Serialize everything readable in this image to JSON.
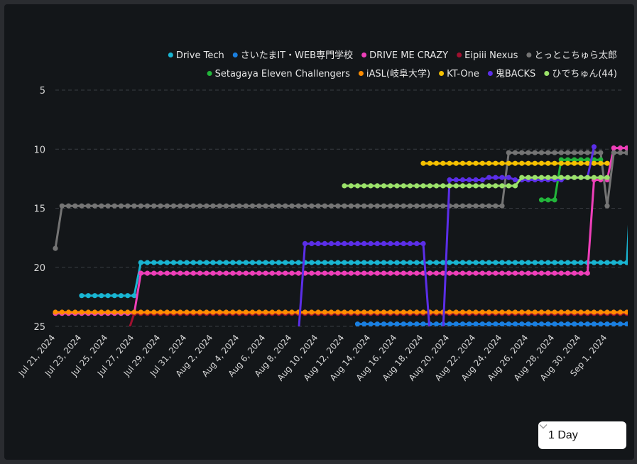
{
  "chart_data": {
    "type": "line",
    "title": "",
    "xlabel": "",
    "ylabel": "",
    "y_axis_reversed": true,
    "ylim": [
      5,
      25
    ],
    "yticks": [
      5,
      10,
      15,
      20,
      25
    ],
    "xticks": [
      "Jul 21, 2024",
      "Jul 23, 2024",
      "Jul 25, 2024",
      "Jul 27, 2024",
      "Jul 29, 2024",
      "Jul 31, 2024",
      "Aug 2, 2024",
      "Aug 4, 2024",
      "Aug 6, 2024",
      "Aug 8, 2024",
      "Aug 10, 2024",
      "Aug 12, 2024",
      "Aug 14, 2024",
      "Aug 16, 2024",
      "Aug 18, 2024",
      "Aug 20, 2024",
      "Aug 22, 2024",
      "Aug 24, 2024",
      "Aug 26, 2024",
      "Aug 28, 2024",
      "Aug 30, 2024",
      "Sep 1, 2024"
    ],
    "xlim": [
      "2024-07-21",
      "2024-09-01.5"
    ],
    "grid": "horizontal dashed",
    "legend_position": "top-right",
    "series": [
      {
        "name": "Drive Tech",
        "color": "#19b5d2",
        "segments": [
          {
            "start": "2024-07-23",
            "values": [
              22.4,
              22.4,
              22.4,
              22.4,
              22.4,
              22.4,
              22.4,
              22.4,
              22.4,
              19.6,
              19.6,
              19.6,
              19.6,
              19.6,
              19.6,
              19.6,
              19.6,
              19.6,
              19.6,
              19.6,
              19.6,
              19.6,
              19.6,
              19.6,
              19.6,
              19.6,
              19.6,
              19.6,
              19.6,
              19.6,
              19.6,
              19.6,
              19.6,
              19.6,
              19.6,
              19.6,
              19.6,
              19.6,
              19.6,
              19.6,
              19.6,
              19.6,
              19.6,
              19.6,
              19.6,
              19.6,
              19.6,
              19.6,
              19.6,
              19.6,
              19.6,
              19.6,
              19.6,
              19.6,
              19.6,
              19.6,
              19.6,
              19.6,
              19.6,
              19.6,
              19.6,
              19.6,
              19.6,
              19.6,
              19.6,
              19.6,
              19.6,
              19.6,
              19.6,
              19.6,
              19.6,
              19.6,
              19.6,
              19.6,
              19.6,
              19.6,
              19.6,
              19.6,
              19.6,
              19.6,
              19.6,
              19.6,
              19.6,
              19.6,
              8.7,
              8.7,
              8.7
            ]
          }
        ]
      },
      {
        "name": "さいたまIT・WEB専門学校",
        "color": "#1a7fe0",
        "segments": [
          {
            "start": "2024-08-13",
            "values": [
              24.8,
              24.8,
              24.8,
              24.8,
              24.8,
              24.8,
              24.8,
              24.8,
              24.8,
              24.8,
              24.8,
              24.8,
              24.8,
              24.8,
              24.8,
              24.8,
              24.8,
              24.8,
              24.8,
              24.8,
              24.8,
              24.8,
              24.8,
              24.8,
              24.8,
              24.8,
              24.8,
              24.8,
              24.8,
              24.8,
              24.8,
              24.8,
              24.8,
              24.8,
              24.8,
              24.8,
              24.8,
              24.8,
              24.8,
              24.8,
              24.8,
              24.8,
              24.8,
              24.8,
              24.8,
              24.8,
              24.8,
              24.8,
              24.8,
              24.8,
              24.8,
              12.4,
              9.8
            ]
          }
        ]
      },
      {
        "name": "DRIVE ME CRAZY",
        "color": "#ee3fb9",
        "segments": [
          {
            "start": "2024-07-21",
            "values": [
              23.9,
              23.9,
              23.9,
              23.9,
              23.9,
              23.9,
              23.9,
              23.9,
              23.9,
              23.9,
              23.9,
              23.9,
              23.9,
              20.5,
              20.5,
              20.5,
              20.5,
              20.5,
              20.5,
              20.5,
              20.5,
              20.5,
              20.5,
              20.5,
              20.5,
              20.5,
              20.5,
              20.5,
              20.5,
              20.5,
              20.5,
              20.5,
              20.5,
              20.5,
              20.5,
              20.5,
              20.5,
              20.5,
              20.5,
              20.5,
              20.5,
              20.5,
              20.5,
              20.5,
              20.5,
              20.5,
              20.5,
              20.5,
              20.5,
              20.5,
              20.5,
              20.5,
              20.5,
              20.5,
              20.5,
              20.5,
              20.5,
              20.5,
              20.5,
              20.5,
              20.5,
              20.5,
              20.5,
              20.5,
              20.5,
              20.5,
              20.5,
              20.5,
              20.5,
              20.5,
              20.5,
              20.5,
              20.5,
              20.5,
              20.5,
              20.5,
              20.5,
              20.5,
              20.5,
              20.5,
              20.5,
              20.5,
              12.6,
              12.6,
              12.6,
              9.9,
              9.9,
              9.9,
              9.9,
              9.9,
              9.9
            ]
          }
        ]
      },
      {
        "name": "Eipiii Nexus",
        "color": "#a0102f",
        "segments": [
          {
            "start": "2024-07-26.5",
            "values": [
              25.6,
              23.9,
              23.9,
              23.9,
              23.9,
              23.9,
              23.9,
              23.9,
              23.9,
              23.9,
              23.9,
              23.9,
              23.9,
              23.9,
              23.9,
              23.9,
              23.9,
              23.9,
              23.9,
              23.9,
              23.9,
              23.9,
              23.9,
              23.9,
              23.9,
              23.9,
              23.9,
              23.9,
              23.9,
              23.9,
              23.9,
              23.9,
              23.9,
              23.9,
              23.9,
              23.9,
              23.9,
              23.9,
              23.9,
              23.9,
              23.9,
              23.9,
              23.9,
              23.9,
              23.9,
              23.9,
              23.9,
              23.9,
              23.9,
              23.9,
              23.9,
              23.9,
              23.9,
              23.9,
              23.9,
              23.9,
              23.9,
              23.9,
              23.9,
              23.9,
              23.9,
              23.9,
              23.9,
              23.9,
              23.9,
              23.9,
              23.9,
              23.9,
              23.9,
              23.9,
              23.9,
              23.9,
              23.9,
              23.9,
              23.9,
              23.9,
              23.9,
              23.9,
              23.9,
              23.9,
              23.9,
              23.9,
              9.8
            ]
          }
        ]
      },
      {
        "name": "とっとこちゅら太郎",
        "color": "#747474",
        "segments": [
          {
            "start": "2024-07-21",
            "values": [
              18.4,
              14.8,
              14.8,
              14.8,
              14.8,
              14.8,
              14.8,
              14.8,
              14.8,
              14.8,
              14.8,
              14.8,
              14.8,
              14.8,
              14.8,
              14.8,
              14.8,
              14.8,
              14.8,
              14.8,
              14.8,
              14.8,
              14.8,
              14.8,
              14.8,
              14.8,
              14.8,
              14.8,
              14.8,
              14.8,
              14.8,
              14.8,
              14.8,
              14.8,
              14.8,
              14.8,
              14.8,
              14.8,
              14.8,
              14.8,
              14.8,
              14.8,
              14.8,
              14.8,
              14.8,
              14.8,
              14.8,
              14.8,
              14.8,
              14.8,
              14.8,
              14.8,
              14.8,
              14.8,
              14.8,
              14.8,
              14.8,
              14.8,
              14.8,
              14.8,
              14.8,
              14.8,
              14.8,
              14.8,
              14.8,
              14.8,
              14.8,
              14.8,
              14.8,
              10.3,
              10.3,
              10.3,
              10.3,
              10.3,
              10.3,
              10.3,
              10.3,
              10.3,
              10.3,
              10.3,
              10.3,
              10.3,
              10.3,
              10.3,
              14.8,
              10.3,
              10.3,
              10.3,
              10.3,
              10.3,
              10.3,
              10.3,
              10.3,
              10.3,
              10.3
            ]
          }
        ]
      },
      {
        "name": "Setagaya Eleven Challengers",
        "color": "#22b53a",
        "segments": [
          {
            "start": "2024-08-27",
            "values": [
              14.3,
              14.3,
              14.3,
              10.9,
              10.9,
              10.9,
              10.9,
              10.9,
              10.9,
              10.9
            ]
          }
        ]
      },
      {
        "name": "iASL(岐阜大学)",
        "color": "#ff8c00",
        "segments": [
          {
            "start": "2024-07-21",
            "values": [
              23.8,
              23.8,
              23.8,
              23.8,
              23.8,
              23.8,
              23.8,
              23.8,
              23.8,
              23.8,
              23.8,
              23.8,
              23.8,
              23.8,
              23.8,
              23.8,
              23.8,
              23.8,
              23.8,
              23.8,
              23.8,
              23.8,
              23.8,
              23.8,
              23.8,
              23.8,
              23.8,
              23.8,
              23.8,
              23.8,
              23.8,
              23.8,
              23.8,
              23.8,
              23.8,
              23.8,
              23.8,
              23.8,
              23.8,
              23.8,
              23.8,
              23.8,
              23.8,
              23.8,
              23.8,
              23.8,
              23.8,
              23.8,
              23.8,
              23.8,
              23.8,
              23.8,
              23.8,
              23.8,
              23.8,
              23.8,
              23.8,
              23.8,
              23.8,
              23.8,
              23.8,
              23.8,
              23.8,
              23.8,
              23.8,
              23.8,
              23.8,
              23.8,
              23.8,
              23.8,
              23.8,
              23.8,
              23.8,
              23.8,
              23.8,
              23.8,
              23.8,
              23.8,
              23.8,
              23.8,
              23.8,
              23.8,
              23.8,
              23.8,
              23.8,
              23.8,
              23.8,
              23.8,
              23.8,
              23.8,
              23.8,
              23.8,
              23.8,
              10.5
            ]
          }
        ]
      },
      {
        "name": "KT-One",
        "color": "#f5c000",
        "segments": [
          {
            "start": "2024-08-18",
            "values": [
              11.2,
              11.2,
              11.2,
              11.2,
              11.2,
              11.2,
              11.2,
              11.2,
              11.2,
              11.2,
              11.2,
              11.2,
              11.2,
              11.2,
              11.2,
              11.2,
              11.2,
              11.2,
              11.2,
              11.2,
              11.2,
              11.2,
              11.2,
              11.2,
              11.2,
              11.2,
              11.2,
              11.2,
              11.2
            ]
          }
        ]
      },
      {
        "name": "鬼BACKS",
        "color": "#5b2ee8",
        "segments": [
          {
            "start": "2024-08-8.5",
            "values": [
              25.6,
              18.0,
              18.0,
              18.0,
              18.0,
              18.0,
              18.0,
              18.0,
              18.0,
              18.0,
              18.0,
              18.0,
              18.0,
              18.0,
              18.0,
              18.0,
              18.0,
              18.0,
              18.0,
              18.0,
              25.6
            ]
          },
          {
            "start": "2024-08-19.5",
            "values": [
              25.6,
              12.6,
              12.6,
              12.6,
              12.6,
              12.6,
              12.6,
              12.4,
              12.4,
              12.4,
              12.4,
              12.6,
              12.6,
              12.6,
              12.6,
              12.6,
              12.6,
              12.6,
              12.6,
              12.4,
              12.4,
              12.4,
              12.4,
              9.8
            ]
          }
        ]
      },
      {
        "name": "ひでちゅん(44)",
        "color": "#9be26a",
        "segments": [
          {
            "start": "2024-08-12",
            "values": [
              13.1,
              13.1,
              13.1,
              13.1,
              13.1,
              13.1,
              13.1,
              13.1,
              13.1,
              13.1,
              13.1,
              13.1,
              13.1,
              13.1,
              13.1,
              13.1,
              13.1,
              13.1,
              13.1,
              13.1,
              13.1,
              13.1,
              13.1,
              13.1,
              13.1,
              13.1,
              13.1,
              12.4,
              12.4,
              12.4,
              12.4,
              12.4,
              12.4,
              12.4,
              12.4,
              12.4,
              12.4,
              12.4,
              12.4,
              12.4,
              12.4
            ]
          }
        ]
      }
    ]
  },
  "controls": {
    "interval_label": "1 Day"
  }
}
